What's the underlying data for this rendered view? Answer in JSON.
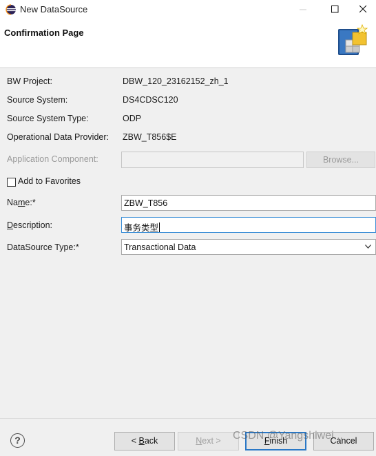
{
  "window": {
    "title": "New DataSource",
    "icon": "eclipse-icon"
  },
  "banner": {
    "title": "Confirmation Page",
    "icon": "wizard-datasource-icon"
  },
  "info": {
    "bw_project_label": "BW Project:",
    "bw_project_value": "DBW_120_23162152_zh_1",
    "source_system_label": "Source System:",
    "source_system_value": "DS4CDSC120",
    "source_system_type_label": "Source System Type:",
    "source_system_type_value": "ODP",
    "odp_label": "Operational Data Provider:",
    "odp_value": "ZBW_T856$E"
  },
  "form": {
    "app_component_label": "Application Component:",
    "app_component_value": "",
    "browse_label": "Browse...",
    "add_favorites_label": "Add to Favorites",
    "add_favorites_checked": false,
    "name_label_pre": "Na",
    "name_label_mnemonic": "m",
    "name_label_post": "e:*",
    "name_value": "ZBW_T856",
    "description_label_mnemonic": "D",
    "description_label_post": "escription:",
    "description_value": "事务类型",
    "datasource_type_label": "DataSource Type:*",
    "datasource_type_value": "Transactional Data"
  },
  "footer": {
    "help_label": "?",
    "back_pre": "< ",
    "back_mnemonic": "B",
    "back_post": "ack",
    "next_mnemonic": "N",
    "next_post": "ext >",
    "finish_mnemonic": "F",
    "finish_post": "inish",
    "cancel_label": "Cancel"
  },
  "watermark": "CSDN @Yangshiwei...",
  "colors": {
    "focus_border": "#3c8fd6",
    "default_button_border": "#2a78c6",
    "dialog_bg": "#f0f0f0"
  }
}
